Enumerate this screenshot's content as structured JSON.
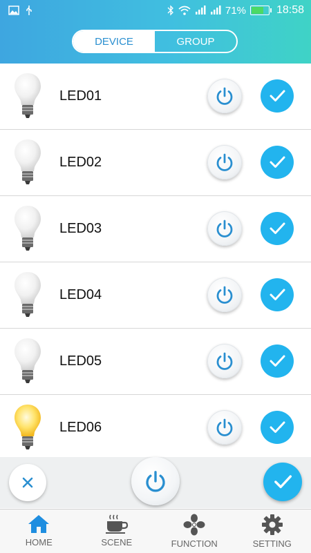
{
  "status_bar": {
    "battery": "71%",
    "time": "18:58",
    "battery_level": 0.71
  },
  "tabs": [
    {
      "label": "DEVICE",
      "active": true
    },
    {
      "label": "GROUP",
      "active": false
    }
  ],
  "devices": [
    {
      "name": "LED01",
      "lit": false,
      "selected": true
    },
    {
      "name": "LED02",
      "lit": false,
      "selected": true
    },
    {
      "name": "LED03",
      "lit": false,
      "selected": true
    },
    {
      "name": "LED04",
      "lit": false,
      "selected": true
    },
    {
      "name": "LED05",
      "lit": false,
      "selected": true
    },
    {
      "name": "LED06",
      "lit": true,
      "selected": true
    }
  ],
  "bottom_nav": [
    {
      "label": "HOME",
      "icon": "home-icon",
      "active": true
    },
    {
      "label": "SCENE",
      "icon": "coffee-cup-icon",
      "active": false
    },
    {
      "label": "FUNCTION",
      "icon": "fan-icon",
      "active": false
    },
    {
      "label": "SETTING",
      "icon": "gear-icon",
      "active": false
    }
  ],
  "colors": {
    "accent": "#22b4ee",
    "header_start": "#3ea6e0",
    "header_end": "#3fd3c6",
    "nav_active": "#1f8ee0",
    "nav_inactive": "#666666"
  }
}
